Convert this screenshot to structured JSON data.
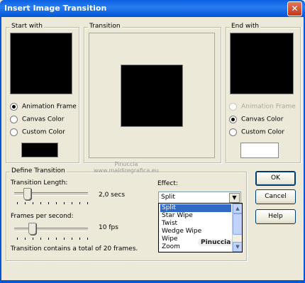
{
  "window": {
    "title": "Insert Image Transition",
    "close_glyph": "✕"
  },
  "start_with": {
    "label": "Start with",
    "options": [
      {
        "label": "Animation Frame",
        "checked": true
      },
      {
        "label": "Canvas Color",
        "checked": false
      },
      {
        "label": "Custom Color",
        "checked": false
      }
    ],
    "swatch_color": "#000000"
  },
  "transition": {
    "label": "Transition"
  },
  "end_with": {
    "label": "End with",
    "options": [
      {
        "label": "Animation Frame",
        "checked": false,
        "disabled": true
      },
      {
        "label": "Canvas Color",
        "checked": true
      },
      {
        "label": "Custom Color",
        "checked": false
      }
    ],
    "swatch_color": "#ffffff"
  },
  "define": {
    "label": "Define Transition",
    "length_label": "Transition Length:",
    "length_value": "2,0 secs",
    "length_slider_position": 0.17,
    "fps_label": "Frames per second:",
    "fps_value": "10 fps",
    "fps_slider_position": 0.24,
    "summary": "Transition contains a total of 20 frames.",
    "effect_label": "Effect:",
    "effect_selected": "Split",
    "effect_options": [
      "Split",
      "Star Wipe",
      "Twist",
      "Wedge Wipe",
      "Wipe",
      "Zoom"
    ]
  },
  "buttons": {
    "ok": "OK",
    "cancel": "Cancel",
    "help": "Help"
  },
  "watermarks": {
    "author": "Pinuccia",
    "site": "www.maldiregrafica.eu",
    "badge": "Pinuccia"
  }
}
